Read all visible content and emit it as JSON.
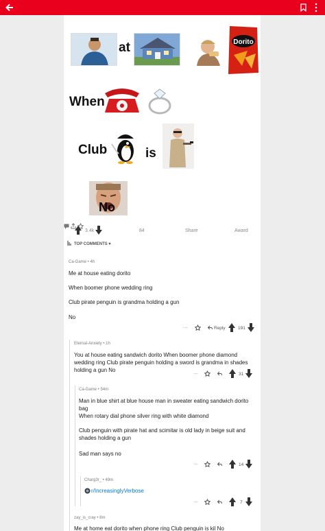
{
  "post": {
    "meme": {
      "row1_word": "at",
      "row2_word": "When",
      "row3_word_a": "Club",
      "row3_word_b": "is",
      "row4_overlay": "No",
      "chips_brand": "Dorito"
    },
    "actions": {
      "upvotes": "3.4k",
      "comments": "84",
      "share": "Share",
      "award": "Award"
    }
  },
  "top_comments_label": "TOP COMMENTS ▾",
  "comments": [
    {
      "meta": "Ca-Game • 4h",
      "lines": [
        "Me at house eating dorito",
        "When boomer phone wedding ring",
        "Club pirate penguin is grandma holding a gun",
        "No"
      ],
      "reply": "Reply",
      "score": "191"
    },
    {
      "meta": "Eternal-Anxiety • 1h",
      "text": "You at house eating sandwich dorito When boomer phone diamond wedding ring Club pirate penguin holding a sword is grandma in shades holding a gun No",
      "score": "31"
    },
    {
      "meta": "Ca-Game • 54m",
      "lines": [
        "Man in blue shirt at blue house man in sweater eating sandwich dorito bag",
        "When rotary dial phone silver ring with white diamond",
        "Club penguin with pirate hat and scimitar is old lady in beige suit and shades holding a gun",
        "Sad man says no"
      ],
      "score": "14"
    },
    {
      "meta": "Charg3r_ • 49m",
      "subreddit": "r/IncreasinglyVerbose",
      "score": "7"
    },
    {
      "meta": "zay_is_cray • 8m",
      "text": "Me at home eat dorito when phone ring Club penguin is kil No"
    }
  ],
  "colors": {
    "topbar": "#e8001c",
    "link": "#0079d3"
  }
}
